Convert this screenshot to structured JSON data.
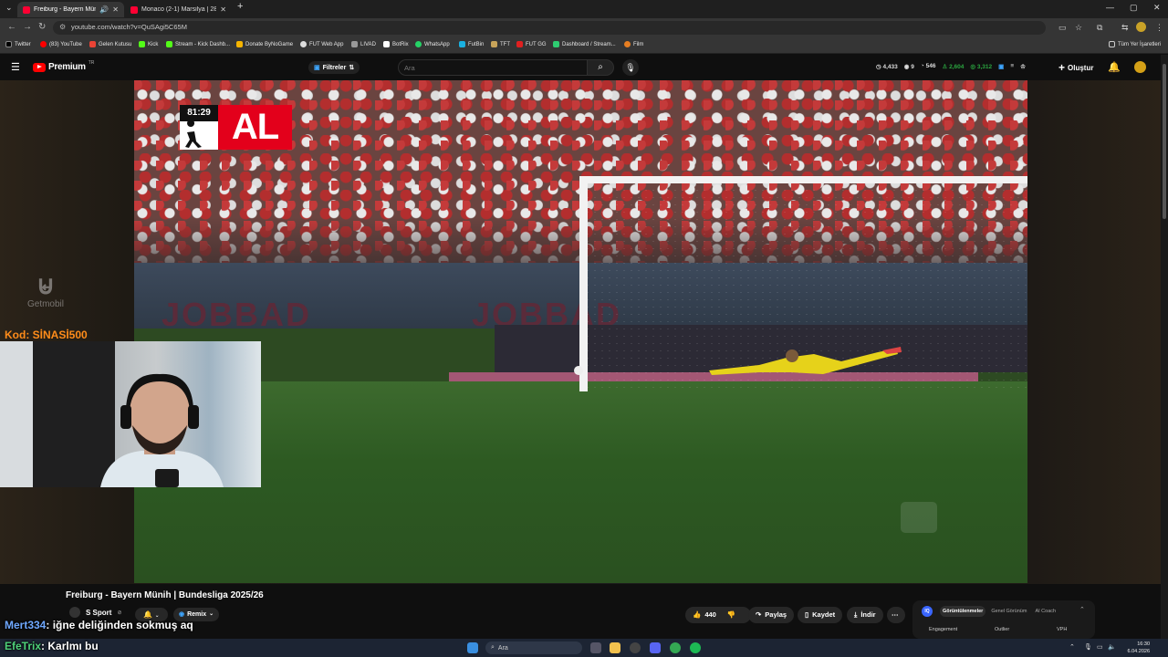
{
  "browser": {
    "tabs": [
      {
        "title": "Freiburg - Bayern Münih | B",
        "active": true
      },
      {
        "title": "Monaco (2-1) Marsilya | 28. Haf",
        "active": false
      }
    ],
    "url": "youtube.com/watch?v=QuSAgi5C65M",
    "bookmarks": [
      "Twitter",
      "(83) YouTube",
      "Gelen Kutusu",
      "Kick",
      "Stream - Kick Dashb...",
      "Donate ByNoGame",
      "FUT Web App",
      "LIVAD",
      "BotRix",
      "WhatsApp",
      "FutBin",
      "TFT",
      "FUT GG",
      "Dashboard / Stream...",
      "Film"
    ],
    "all_bookmarks": "Tüm Yer İşaretleri"
  },
  "youtube": {
    "logo_text": "Premium",
    "logo_cc": "TR",
    "filters_label": "Filtreler",
    "search_placeholder": "Ara",
    "ext_stats": [
      "4,433",
      "9",
      "546",
      "2,604",
      "3,312"
    ],
    "create_label": "Oluştur"
  },
  "video": {
    "match_clock": "81:29",
    "team_abbr": "AL",
    "title": "Freiburg - Bayern Münih | Bundesliga 2025/26",
    "channel": "S Sport",
    "remix_label": "Remix",
    "likes": "440",
    "share_label": "Paylaş",
    "save_label": "Kaydet",
    "download_label": "İndir"
  },
  "analytics": {
    "tabs": [
      "Görüntülenmeler",
      "Genel Görünüm",
      "AI Coach"
    ],
    "metrics": [
      "Engagement",
      "Outlier",
      "VPH"
    ]
  },
  "stream_overlay": {
    "sponsor": "Getmobil",
    "promo_code": "Kod: SİNASİ500",
    "chat": [
      {
        "user": "Mert334",
        "message": ": iğne deliğinden sokmuş aq"
      },
      {
        "user": "EfeTrix",
        "message": ": Karlmı bu"
      }
    ]
  },
  "taskbar": {
    "search_placeholder": "Ara",
    "time": "16:30",
    "date": "6.04.2026"
  },
  "colors": {
    "youtube_red": "#ff0000",
    "score_red": "#e3001b",
    "chat_user": "#6fa8ff",
    "promo": "#ff8c1a"
  }
}
